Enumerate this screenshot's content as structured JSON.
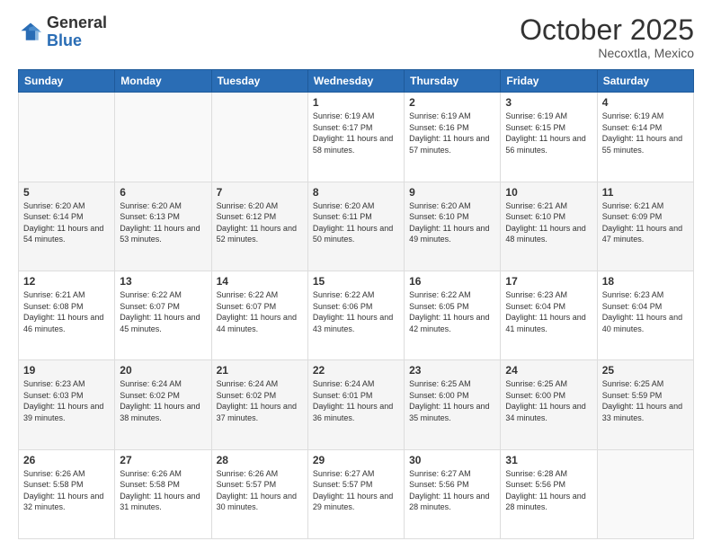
{
  "header": {
    "logo_general": "General",
    "logo_blue": "Blue",
    "month": "October 2025",
    "location": "Necoxtla, Mexico"
  },
  "days_of_week": [
    "Sunday",
    "Monday",
    "Tuesday",
    "Wednesday",
    "Thursday",
    "Friday",
    "Saturday"
  ],
  "weeks": [
    [
      {
        "day": "",
        "info": ""
      },
      {
        "day": "",
        "info": ""
      },
      {
        "day": "",
        "info": ""
      },
      {
        "day": "1",
        "info": "Sunrise: 6:19 AM\nSunset: 6:17 PM\nDaylight: 11 hours\nand 58 minutes."
      },
      {
        "day": "2",
        "info": "Sunrise: 6:19 AM\nSunset: 6:16 PM\nDaylight: 11 hours\nand 57 minutes."
      },
      {
        "day": "3",
        "info": "Sunrise: 6:19 AM\nSunset: 6:15 PM\nDaylight: 11 hours\nand 56 minutes."
      },
      {
        "day": "4",
        "info": "Sunrise: 6:19 AM\nSunset: 6:14 PM\nDaylight: 11 hours\nand 55 minutes."
      }
    ],
    [
      {
        "day": "5",
        "info": "Sunrise: 6:20 AM\nSunset: 6:14 PM\nDaylight: 11 hours\nand 54 minutes."
      },
      {
        "day": "6",
        "info": "Sunrise: 6:20 AM\nSunset: 6:13 PM\nDaylight: 11 hours\nand 53 minutes."
      },
      {
        "day": "7",
        "info": "Sunrise: 6:20 AM\nSunset: 6:12 PM\nDaylight: 11 hours\nand 52 minutes."
      },
      {
        "day": "8",
        "info": "Sunrise: 6:20 AM\nSunset: 6:11 PM\nDaylight: 11 hours\nand 50 minutes."
      },
      {
        "day": "9",
        "info": "Sunrise: 6:20 AM\nSunset: 6:10 PM\nDaylight: 11 hours\nand 49 minutes."
      },
      {
        "day": "10",
        "info": "Sunrise: 6:21 AM\nSunset: 6:10 PM\nDaylight: 11 hours\nand 48 minutes."
      },
      {
        "day": "11",
        "info": "Sunrise: 6:21 AM\nSunset: 6:09 PM\nDaylight: 11 hours\nand 47 minutes."
      }
    ],
    [
      {
        "day": "12",
        "info": "Sunrise: 6:21 AM\nSunset: 6:08 PM\nDaylight: 11 hours\nand 46 minutes."
      },
      {
        "day": "13",
        "info": "Sunrise: 6:22 AM\nSunset: 6:07 PM\nDaylight: 11 hours\nand 45 minutes."
      },
      {
        "day": "14",
        "info": "Sunrise: 6:22 AM\nSunset: 6:07 PM\nDaylight: 11 hours\nand 44 minutes."
      },
      {
        "day": "15",
        "info": "Sunrise: 6:22 AM\nSunset: 6:06 PM\nDaylight: 11 hours\nand 43 minutes."
      },
      {
        "day": "16",
        "info": "Sunrise: 6:22 AM\nSunset: 6:05 PM\nDaylight: 11 hours\nand 42 minutes."
      },
      {
        "day": "17",
        "info": "Sunrise: 6:23 AM\nSunset: 6:04 PM\nDaylight: 11 hours\nand 41 minutes."
      },
      {
        "day": "18",
        "info": "Sunrise: 6:23 AM\nSunset: 6:04 PM\nDaylight: 11 hours\nand 40 minutes."
      }
    ],
    [
      {
        "day": "19",
        "info": "Sunrise: 6:23 AM\nSunset: 6:03 PM\nDaylight: 11 hours\nand 39 minutes."
      },
      {
        "day": "20",
        "info": "Sunrise: 6:24 AM\nSunset: 6:02 PM\nDaylight: 11 hours\nand 38 minutes."
      },
      {
        "day": "21",
        "info": "Sunrise: 6:24 AM\nSunset: 6:02 PM\nDaylight: 11 hours\nand 37 minutes."
      },
      {
        "day": "22",
        "info": "Sunrise: 6:24 AM\nSunset: 6:01 PM\nDaylight: 11 hours\nand 36 minutes."
      },
      {
        "day": "23",
        "info": "Sunrise: 6:25 AM\nSunset: 6:00 PM\nDaylight: 11 hours\nand 35 minutes."
      },
      {
        "day": "24",
        "info": "Sunrise: 6:25 AM\nSunset: 6:00 PM\nDaylight: 11 hours\nand 34 minutes."
      },
      {
        "day": "25",
        "info": "Sunrise: 6:25 AM\nSunset: 5:59 PM\nDaylight: 11 hours\nand 33 minutes."
      }
    ],
    [
      {
        "day": "26",
        "info": "Sunrise: 6:26 AM\nSunset: 5:58 PM\nDaylight: 11 hours\nand 32 minutes."
      },
      {
        "day": "27",
        "info": "Sunrise: 6:26 AM\nSunset: 5:58 PM\nDaylight: 11 hours\nand 31 minutes."
      },
      {
        "day": "28",
        "info": "Sunrise: 6:26 AM\nSunset: 5:57 PM\nDaylight: 11 hours\nand 30 minutes."
      },
      {
        "day": "29",
        "info": "Sunrise: 6:27 AM\nSunset: 5:57 PM\nDaylight: 11 hours\nand 29 minutes."
      },
      {
        "day": "30",
        "info": "Sunrise: 6:27 AM\nSunset: 5:56 PM\nDaylight: 11 hours\nand 28 minutes."
      },
      {
        "day": "31",
        "info": "Sunrise: 6:28 AM\nSunset: 5:56 PM\nDaylight: 11 hours\nand 28 minutes."
      },
      {
        "day": "",
        "info": ""
      }
    ]
  ]
}
